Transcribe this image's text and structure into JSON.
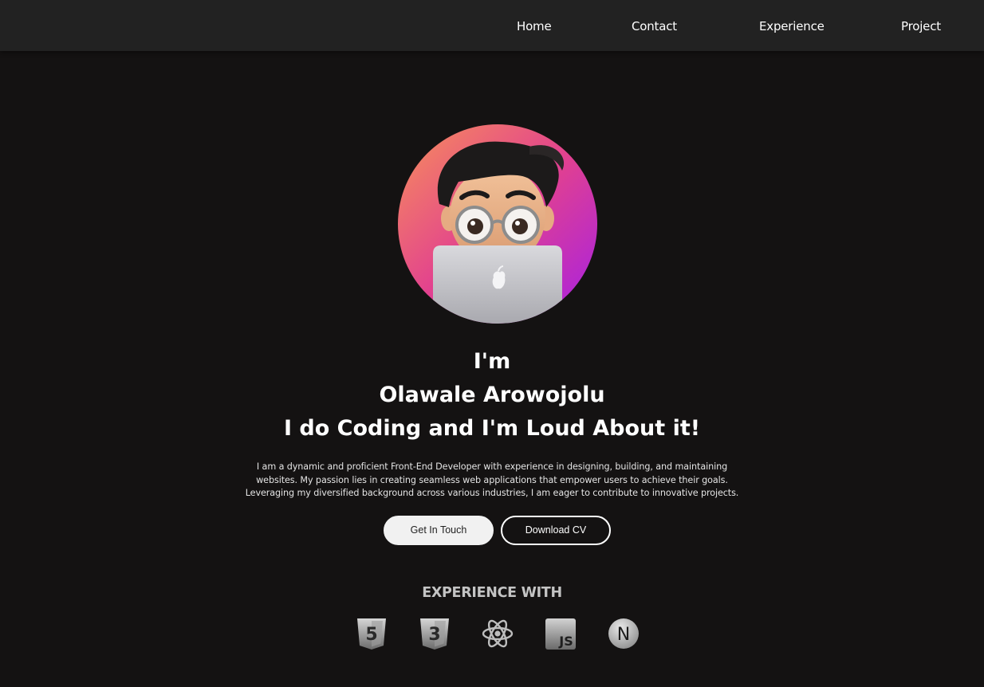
{
  "nav": {
    "items": [
      {
        "label": "Home"
      },
      {
        "label": "Contact"
      },
      {
        "label": "Experience"
      },
      {
        "label": "Project"
      }
    ]
  },
  "hero": {
    "greeting": "I'm",
    "name": "Olawale Arowojolu",
    "tagline": "I do Coding and I'm Loud About it!",
    "bio": "I am a dynamic and proficient Front-End Developer with experience in designing, building, and maintaining websites. My passion lies in creating seamless web applications that empower users to achieve their goals. Leveraging my diversified background across various industries, I am eager to contribute to innovative projects.",
    "avatar_icon": "memoji-avatar-with-laptop"
  },
  "actions": {
    "primary_label": "Get In Touch",
    "secondary_label": "Download CV"
  },
  "experience": {
    "title": "EXPERIENCE WITH",
    "icons": [
      "html5-icon",
      "css3-icon",
      "react-icon",
      "javascript-icon",
      "nextjs-icon"
    ],
    "js_label": "JS",
    "html_label": "5",
    "css_label": "3",
    "next_label": "N"
  },
  "colors": {
    "background": "#141212",
    "navbar": "#222222",
    "avatar_gradient_start": "#f47a5c",
    "avatar_gradient_mid": "#e2418f",
    "avatar_gradient_end": "#b027e3"
  }
}
